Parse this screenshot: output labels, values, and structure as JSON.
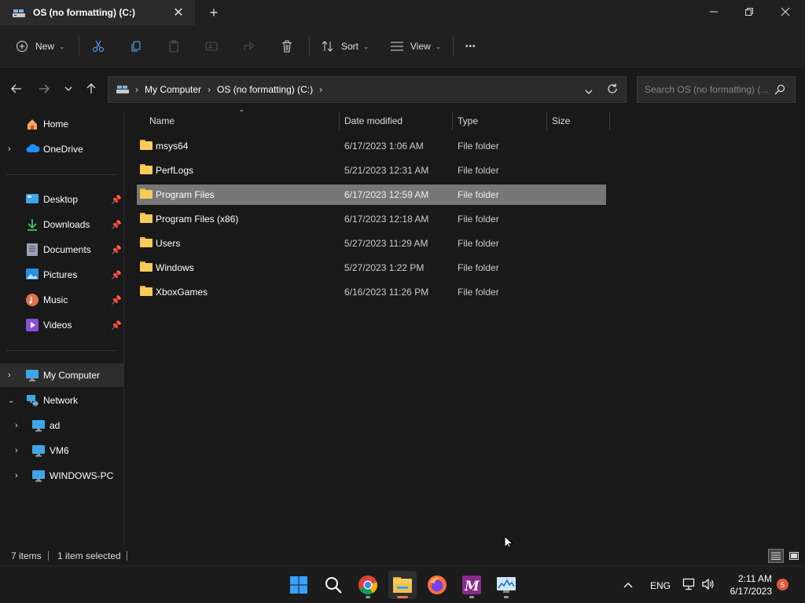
{
  "window": {
    "tab_title": "OS (no formatting) (C:)",
    "tab_close": "✕",
    "new_tab": "+"
  },
  "commands": {
    "new_label": "New",
    "sort_label": "Sort",
    "view_label": "View",
    "more": "•••"
  },
  "address": {
    "crumbs": [
      "My Computer",
      "OS (no formatting) (C:)"
    ],
    "search_placeholder": "Search OS (no formatting) (..."
  },
  "sidebar": {
    "items": [
      {
        "label": "Home"
      },
      {
        "label": "OneDrive"
      },
      {
        "label": "Desktop"
      },
      {
        "label": "Downloads"
      },
      {
        "label": "Documents"
      },
      {
        "label": "Pictures"
      },
      {
        "label": "Music"
      },
      {
        "label": "Videos"
      },
      {
        "label": "My Computer"
      },
      {
        "label": "Network"
      },
      {
        "label": "ad"
      },
      {
        "label": "VM6"
      },
      {
        "label": "WINDOWS-PC"
      }
    ]
  },
  "columns": {
    "name": "Name",
    "date": "Date modified",
    "type": "Type",
    "size": "Size"
  },
  "files": [
    {
      "name": "msys64",
      "date": "6/17/2023 1:06 AM",
      "type": "File folder"
    },
    {
      "name": "PerfLogs",
      "date": "5/21/2023 12:31 AM",
      "type": "File folder"
    },
    {
      "name": "Program Files",
      "date": "6/17/2023 12:59 AM",
      "type": "File folder"
    },
    {
      "name": "Program Files (x86)",
      "date": "6/17/2023 12:18 AM",
      "type": "File folder"
    },
    {
      "name": "Users",
      "date": "5/27/2023 11:29 AM",
      "type": "File folder"
    },
    {
      "name": "Windows",
      "date": "5/27/2023 1:22 PM",
      "type": "File folder"
    },
    {
      "name": "XboxGames",
      "date": "6/16/2023 11:26 PM",
      "type": "File folder"
    }
  ],
  "status": {
    "items_count": "7 items",
    "selected": "1 item selected"
  },
  "taskbar": {
    "lang": "ENG",
    "time": "2:11 AM",
    "date": "6/17/2023",
    "notif_count": "5"
  },
  "colors": {
    "accent": "#0078d4",
    "folder": "#f8cc5a",
    "selection": "#777777",
    "background": "#191919"
  }
}
